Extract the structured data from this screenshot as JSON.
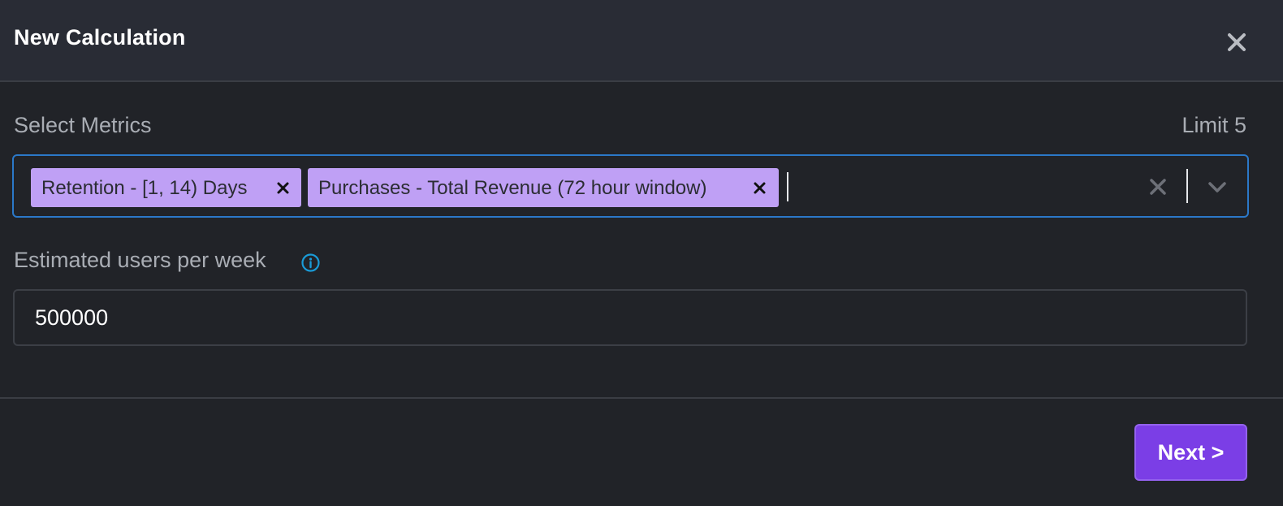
{
  "modal": {
    "title": "New Calculation",
    "close_icon": "close-icon"
  },
  "metrics": {
    "label": "Select Metrics",
    "limit_label": "Limit 5",
    "selected": [
      {
        "label": "Retention - [1, 14) Days",
        "remove_icon": "close-icon"
      },
      {
        "label": "Purchases - Total Revenue (72 hour window)",
        "remove_icon": "close-icon"
      }
    ],
    "clear_icon": "close-icon",
    "dropdown_icon": "chevron-down-icon",
    "focus_color": "#2b78c8",
    "chip_color": "#bfa0f5"
  },
  "users": {
    "label": "Estimated users per week",
    "info_icon": "info-icon",
    "value": "500000"
  },
  "footer": {
    "next_label": "Next >",
    "accent_color": "#7b3ee6"
  }
}
